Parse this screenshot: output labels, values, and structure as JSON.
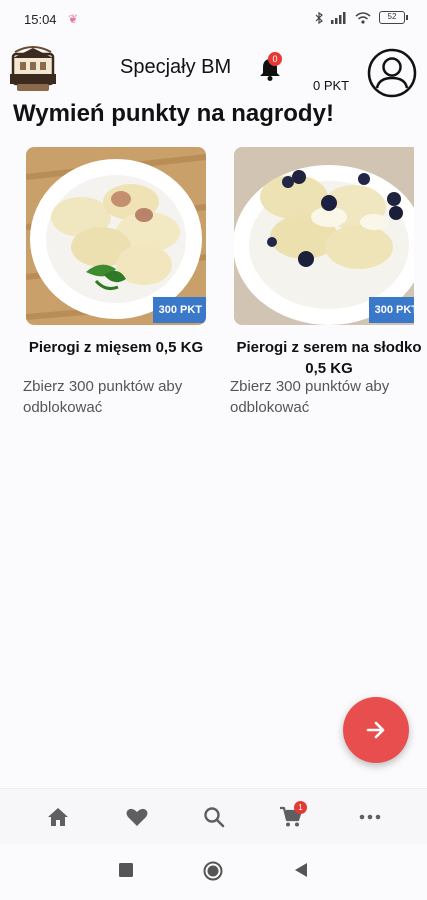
{
  "status_bar": {
    "time": "15:04",
    "battery": "52"
  },
  "header": {
    "logo_name": "specjaly-bm-logo",
    "title": "Specjały BM",
    "notification_count": "0",
    "points": "0 PKT"
  },
  "page": {
    "title": "Wymień punkty na nagrody!"
  },
  "rewards": [
    {
      "name": "Pierogi z mięsem 0,5 KG",
      "points_badge": "300 PKT",
      "note": "Zbierz 300 punktów aby odblokować"
    },
    {
      "name": "Pierogi z serem na słodko  0,5 KG",
      "points_badge": "300 PKT",
      "note": "Zbierz 300 punktów aby odblokować"
    }
  ],
  "bottom_nav": {
    "cart_count": "1",
    "icons": [
      "home-icon",
      "heart-icon",
      "search-icon",
      "cart-icon",
      "more-icon"
    ]
  },
  "colors": {
    "accent_red": "#e94e4e",
    "badge_blue": "#3a78c9",
    "badge_red": "#e53935"
  }
}
